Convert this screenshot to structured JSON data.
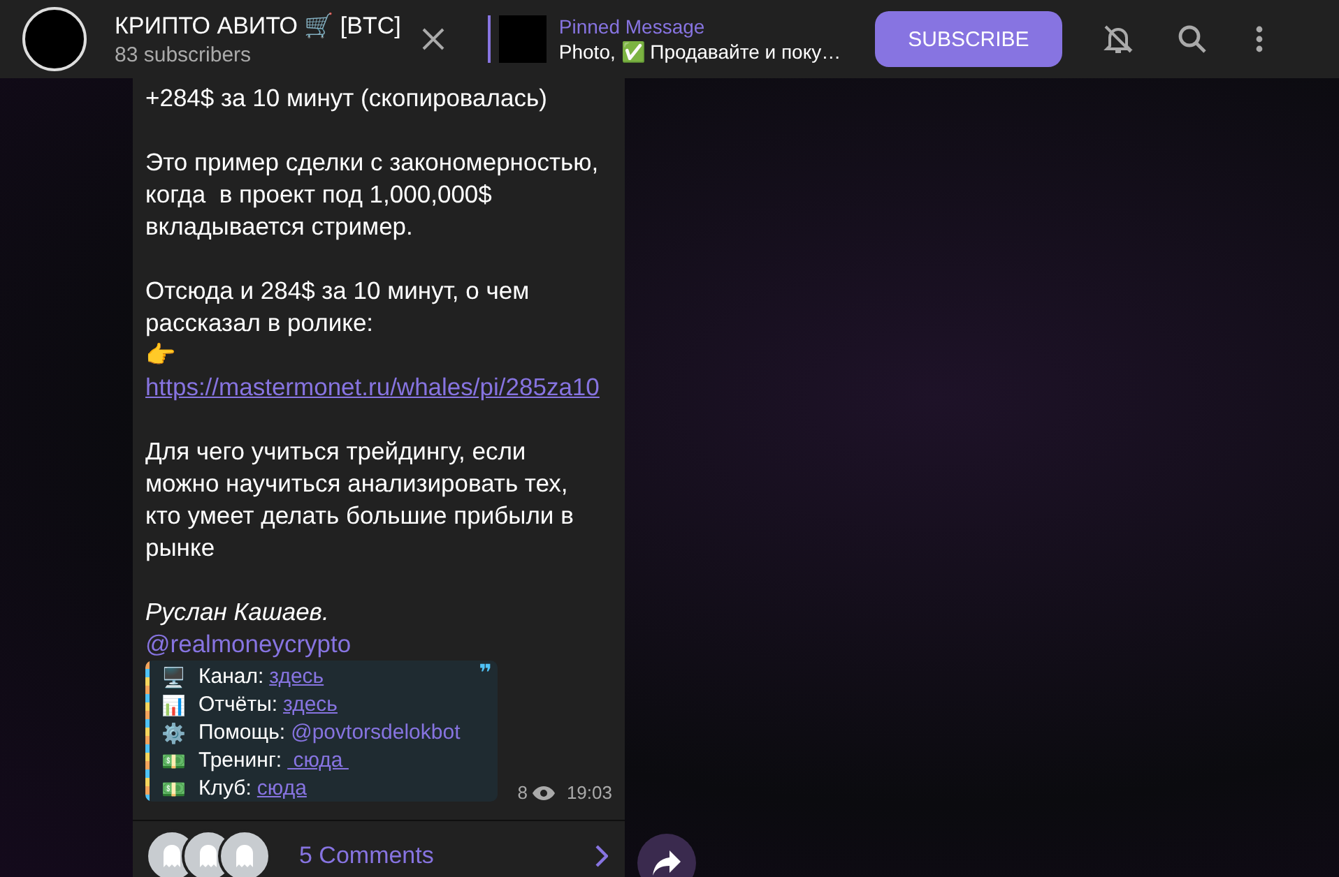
{
  "header": {
    "channel_title": "КРИПТО АВИТО 🛒 [BTC]",
    "subscribers": "83 subscribers",
    "pinned": {
      "label": "Pinned Message",
      "text": "Photo, ✅  Продавайте и поку…"
    },
    "subscribe_button": "SUBSCRIBE"
  },
  "message": {
    "blocks": [
      [
        {
          "kind": "text",
          "text": "+284$ за 10 минут (скопировалась)"
        }
      ],
      [
        {
          "kind": "text",
          "text": "Это пример сделки с закономерностью,\nкогда  в проект под 1,000,000$\nвкладывается стример."
        }
      ],
      [
        {
          "kind": "text",
          "text": "Отсюда и 284$ за 10 минут, о чем\nрассказал в ролике:\n👉"
        },
        {
          "kind": "link",
          "text": "https://mastermonet.ru/whales/pi/285za10"
        }
      ],
      [
        {
          "kind": "text",
          "text": "Для чего учиться трейдингу, если\nможно научиться анализировать тех,\nкто умеет делать большие прибыли в\nрынке"
        }
      ],
      [
        {
          "kind": "italic",
          "text": "Руслан Кашаев."
        },
        {
          "kind": "mention",
          "text": "@realmoneycrypto"
        }
      ]
    ],
    "quote": {
      "mark": "❞",
      "rows": [
        {
          "emoji": "🖥️",
          "label": "Канал:",
          "value": "здесь",
          "kind": "link"
        },
        {
          "emoji": "📊",
          "label": "Отчёты:",
          "value": "здесь",
          "kind": "link"
        },
        {
          "emoji": "⚙️",
          "label": "Помощь:",
          "value": "@povtorsdelokbot",
          "kind": "mention"
        },
        {
          "emoji": "💵",
          "label": "Тренинг:",
          "value": " сюда ",
          "kind": "link"
        },
        {
          "emoji": "💵",
          "label": "Клуб:",
          "value": "сюда",
          "kind": "link"
        }
      ]
    },
    "views": "8",
    "time": "19:03",
    "comments": "5 Comments"
  }
}
